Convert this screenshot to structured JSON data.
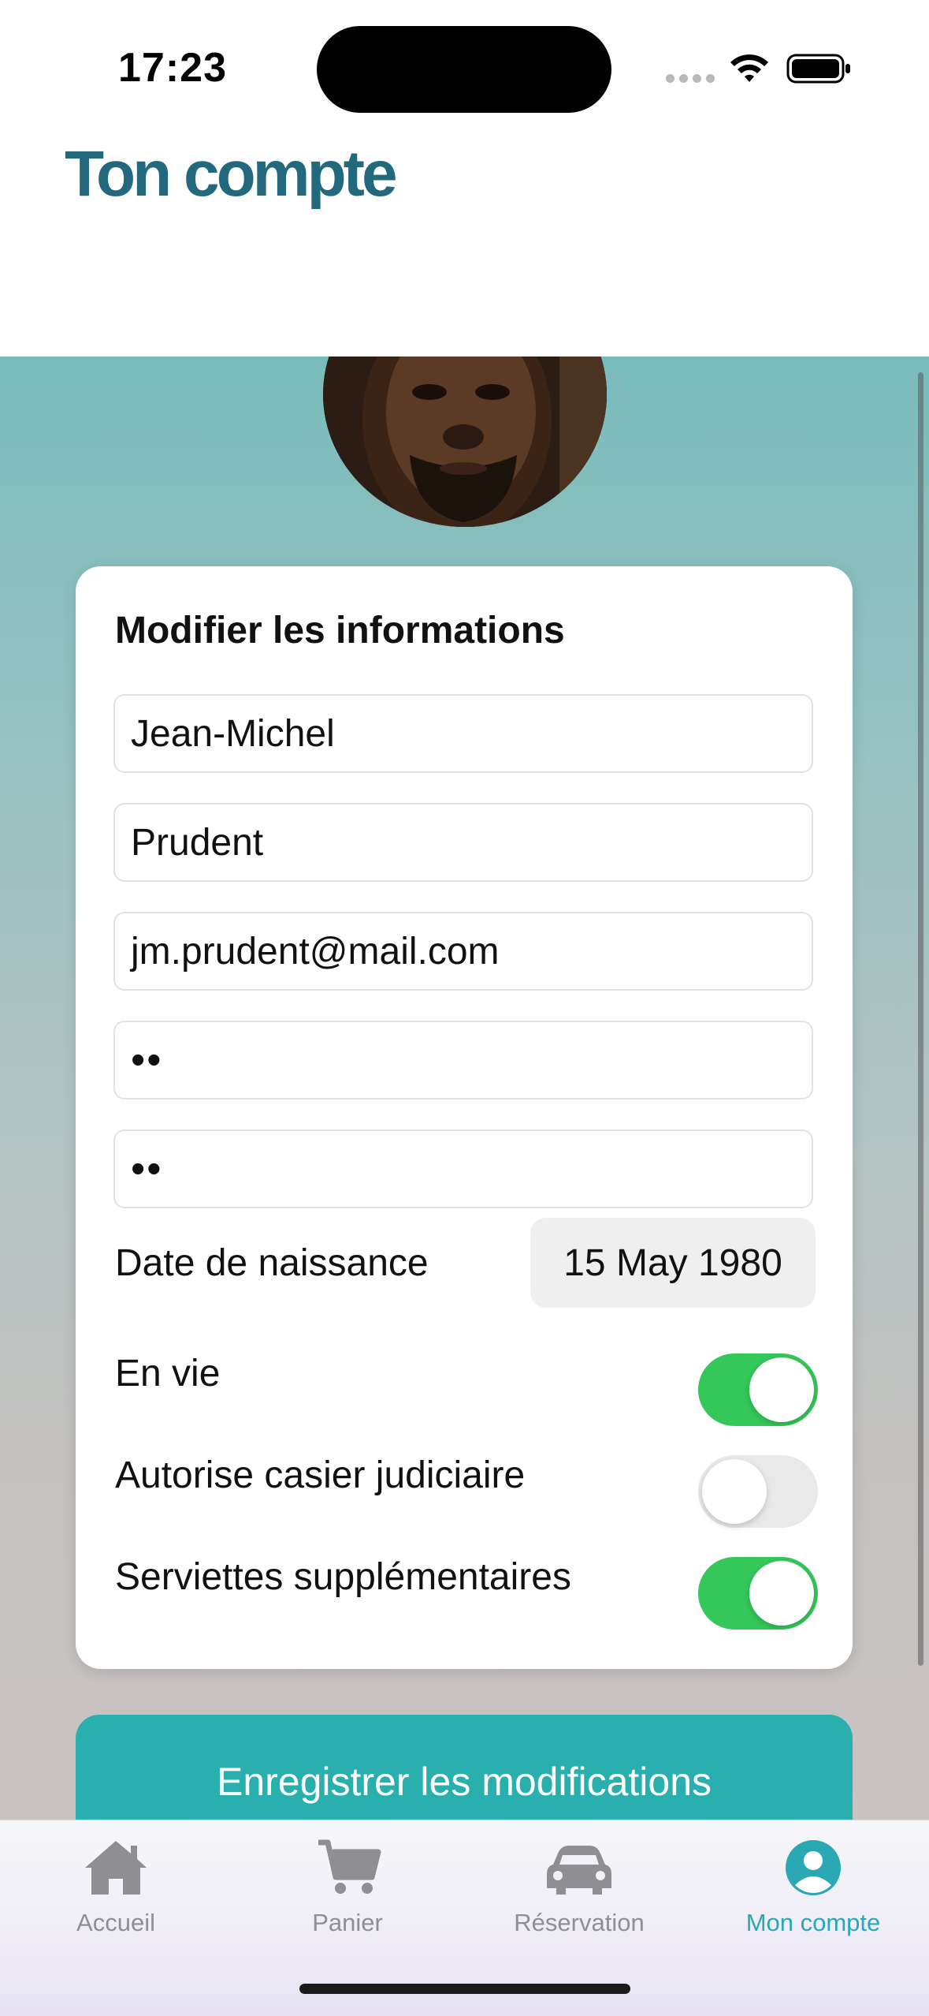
{
  "status_bar": {
    "time": "17:23"
  },
  "header": {
    "title": "Ton compte"
  },
  "form": {
    "title": "Modifier les informations",
    "first_name": "Jean-Michel",
    "last_name": "Prudent",
    "email": "jm.prudent@mail.com",
    "password": "••",
    "password_confirm": "••",
    "birth_date_label": "Date de naissance",
    "birth_date_value": "15 May 1980",
    "toggles": [
      {
        "label": "En vie",
        "on": true
      },
      {
        "label": "Autorise casier judiciaire",
        "on": false
      },
      {
        "label": "Serviettes supplémentaires",
        "on": true
      }
    ]
  },
  "save_label": "Enregistrer les modifications",
  "tabs": [
    {
      "label": "Accueil",
      "icon": "house-icon",
      "active": false
    },
    {
      "label": "Panier",
      "icon": "cart-icon",
      "active": false
    },
    {
      "label": "Réservation",
      "icon": "car-icon",
      "active": false
    },
    {
      "label": "Mon compte",
      "icon": "person-circle-icon",
      "active": true
    }
  ],
  "colors": {
    "title": "#22697e",
    "accent": "#2aafaf",
    "toggle_on": "#34c759",
    "tab_active": "#2aa8b4",
    "tab_inactive": "#8e8e93"
  }
}
